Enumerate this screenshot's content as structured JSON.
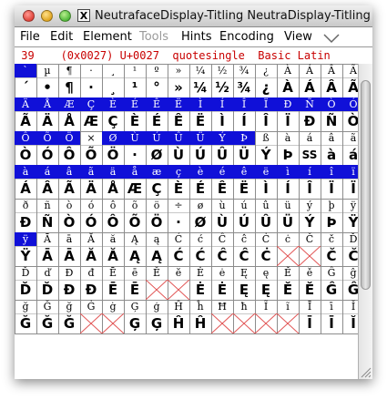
{
  "window": {
    "title": "NeutrafaceDisplay-Titling  NeutraDisplay-Titling",
    "x11_label": "X"
  },
  "menubar": {
    "items": [
      {
        "label": "File",
        "enabled": true
      },
      {
        "label": "Edit",
        "enabled": true
      },
      {
        "label": "Element",
        "enabled": true
      },
      {
        "label": "Tools",
        "enabled": false
      },
      {
        "label": "Hints",
        "enabled": true
      },
      {
        "label": "Encoding",
        "enabled": true
      },
      {
        "label": "View",
        "enabled": true
      }
    ]
  },
  "info": {
    "text": " 39    (0x0027) U+0027  quotesingle  Basic Latin"
  },
  "colors": {
    "selected_label_bg": "#1010d8",
    "info_text": "#c80000",
    "empty_cross": "#e05050"
  },
  "grid": {
    "rows": [
      {
        "labels": [
          "`",
          "µ",
          "¶",
          "·",
          "¸",
          "¹",
          "º",
          "»",
          "¼",
          "½",
          "¾",
          "¿",
          "À",
          "Á",
          "Â",
          "Ã"
        ],
        "glyphs": [
          "´",
          "•",
          "¶",
          "·",
          "¸",
          "¹",
          "°",
          "»",
          "¼",
          "½",
          "¾",
          "¿",
          "À",
          "Á",
          "Â",
          "Ã"
        ]
      },
      {
        "labels": [
          "Ä",
          "Å",
          "Æ",
          "Ç",
          "È",
          "É",
          "Ê",
          "Ë",
          "Ì",
          "Í",
          "Î",
          "Ï",
          "Ð",
          "Ñ",
          "Ò",
          "Ó"
        ],
        "glyphs": [
          "Ã",
          "Ä",
          "Å",
          "Æ",
          "Ç",
          "È",
          "É",
          "Ê",
          "Ë",
          "Ì",
          "Í",
          "Î",
          "Ï",
          "Ð",
          "Ñ",
          "Ò"
        ]
      },
      {
        "labels": [
          "Ô",
          "Õ",
          "Ö",
          "×",
          "Ø",
          "Ù",
          "Ú",
          "Û",
          "Ü",
          "Ý",
          "Þ",
          "ß",
          "à",
          "á",
          "â",
          "ã"
        ],
        "glyphs": [
          "Ò",
          "Ó",
          "Ô",
          "Õ",
          "Ö",
          "·",
          "Ø",
          "Ù",
          "Ú",
          "Û",
          "Ü",
          "Ý",
          "Þ",
          "SS",
          "à",
          "á"
        ]
      },
      {
        "labels": [
          "à",
          "á",
          "â",
          "ã",
          "ä",
          "å",
          "æ",
          "ç",
          "è",
          "é",
          "ê",
          "ë",
          "ì",
          "í",
          "î",
          "ï"
        ],
        "glyphs": [
          "Á",
          "Â",
          "Ã",
          "Ä",
          "Å",
          "Æ",
          "Ç",
          "È",
          "É",
          "Ê",
          "Ë",
          "Ì",
          "Í",
          "Î",
          "Ï",
          "Ï"
        ]
      },
      {
        "labels": [
          "ð",
          "ñ",
          "ò",
          "ó",
          "ô",
          "õ",
          "ö",
          "÷",
          "ø",
          "ù",
          "ú",
          "û",
          "ü",
          "ý",
          "þ",
          "ÿ"
        ],
        "glyphs": [
          "Đ",
          "Ñ",
          "Ò",
          "Ó",
          "Ô",
          "Õ",
          "Ö",
          "·",
          "Ø",
          "Ù",
          "Ú",
          "Û",
          "Ü",
          "Ý",
          "Þ",
          "Ÿ"
        ]
      },
      {
        "labels": [
          "ÿ",
          "Ā",
          "ā",
          "Ă",
          "ă",
          "Ą",
          "ą",
          "Ć",
          "ć",
          "Ĉ",
          "ĉ",
          "Ċ",
          "ċ",
          "Č",
          "č",
          "Ď"
        ],
        "glyphs": [
          "Ÿ",
          "Ā",
          "Ā",
          "Ă",
          "Ă",
          "Ą",
          "Ą",
          "Ć",
          "Ć",
          "Ĉ",
          "Ĉ",
          "Ċ",
          "",
          "",
          "Č",
          "Č"
        ]
      },
      {
        "labels": [
          "Ď",
          "ď",
          "Đ",
          "đ",
          "Ē",
          "ē",
          "Ĕ",
          "ĕ",
          "Ė",
          "ė",
          "Ę",
          "ę",
          "Ě",
          "ě",
          "Ĝ",
          "ĝ"
        ],
        "glyphs": [
          "Ď",
          "Ď",
          "Đ",
          "Đ",
          "Ē",
          "Ē",
          "",
          "",
          "Ė",
          "Ė",
          "Ę",
          "Ę",
          "Ě",
          "Ě",
          "Ĝ",
          "Ĝ"
        ]
      },
      {
        "labels": [
          "ğ",
          "Ğ",
          "ğ",
          "Ġ",
          "ġ",
          "Ģ",
          "ģ",
          "Ĥ",
          "ĥ",
          "Ħ",
          "ħ",
          "Ĩ",
          "ĩ",
          "Ī",
          "ī",
          "Ĭ"
        ],
        "glyphs": [
          "Ğ",
          "Ğ",
          "Ğ",
          "",
          "",
          "Ģ",
          "Ģ",
          "Ĥ",
          "Ĥ",
          "",
          "",
          "",
          "",
          "Ī",
          "Ī",
          "Ĭ"
        ]
      }
    ],
    "selected_labels": [
      [
        true,
        false,
        false,
        false,
        false,
        false,
        false,
        false,
        false,
        false,
        false,
        false,
        false,
        false,
        false,
        false
      ],
      [
        true,
        true,
        true,
        true,
        true,
        true,
        true,
        true,
        true,
        true,
        true,
        true,
        true,
        true,
        true,
        true
      ],
      [
        true,
        true,
        true,
        false,
        true,
        true,
        true,
        true,
        true,
        true,
        true,
        false,
        false,
        false,
        false,
        false
      ],
      [
        true,
        true,
        true,
        true,
        true,
        true,
        true,
        true,
        true,
        true,
        true,
        true,
        true,
        true,
        true,
        true
      ],
      [
        false,
        false,
        false,
        false,
        false,
        false,
        false,
        false,
        false,
        false,
        false,
        false,
        false,
        false,
        false,
        false
      ],
      [
        true,
        false,
        false,
        false,
        false,
        false,
        false,
        false,
        false,
        false,
        false,
        false,
        false,
        false,
        false,
        false
      ],
      [
        false,
        false,
        false,
        false,
        false,
        false,
        false,
        false,
        false,
        false,
        false,
        false,
        false,
        false,
        false,
        false
      ],
      [
        false,
        false,
        false,
        false,
        false,
        false,
        false,
        false,
        false,
        false,
        false,
        false,
        false,
        false,
        false,
        false
      ]
    ]
  }
}
